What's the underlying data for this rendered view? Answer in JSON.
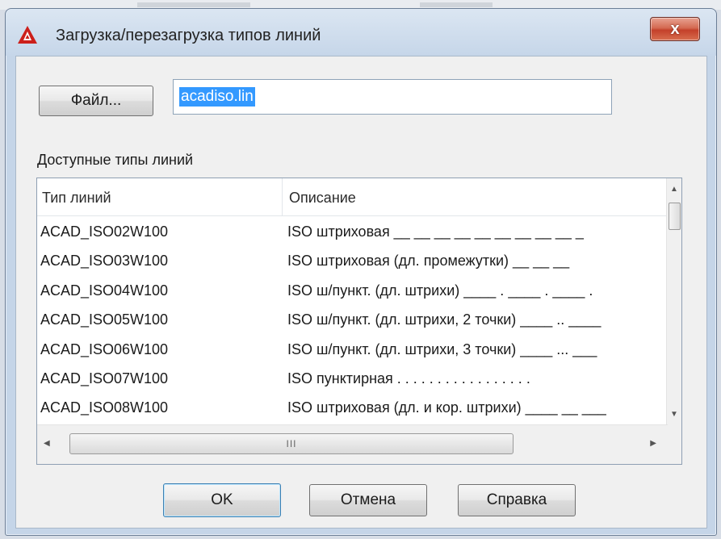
{
  "window": {
    "title": "Загрузка/перезагрузка типов линий",
    "close_label": "x"
  },
  "file": {
    "button_label": "Файл...",
    "value": "acadiso.lin"
  },
  "available_label": "Доступные типы линий",
  "table": {
    "headers": [
      "Тип линий",
      "Описание"
    ],
    "rows": [
      {
        "name": "ACAD_ISO02W100",
        "description": "ISO штриховая __ __ __ __ __ __ __ __ __ _"
      },
      {
        "name": "ACAD_ISO03W100",
        "description": "ISO штриховая (дл. промежутки) __    __    __"
      },
      {
        "name": "ACAD_ISO04W100",
        "description": "ISO ш/пункт. (дл. штрихи) ____ . ____ . ____ ."
      },
      {
        "name": "ACAD_ISO05W100",
        "description": "ISO ш/пункт. (дл. штрихи, 2 точки) ____ .. ____"
      },
      {
        "name": "ACAD_ISO06W100",
        "description": "ISO ш/пункт. (дл. штрихи, 3 точки) ____ ... ___"
      },
      {
        "name": "ACAD_ISO07W100",
        "description": "ISO пунктирная . . . . . . . . . . . . . . . . ."
      },
      {
        "name": "ACAD_ISO08W100",
        "description": "ISO штриховая (дл. и кор. штрихи) ____ __ ___"
      }
    ],
    "hscroll_grip": "III"
  },
  "buttons": {
    "ok": "OK",
    "cancel": "Отмена",
    "help": "Справка"
  },
  "colors": {
    "selection": "#3399ff",
    "close_button": "#c4402a",
    "app_icon": "#cc1f1a"
  },
  "icons": {
    "app": "autocad-logo-icon",
    "close": "close-icon"
  }
}
